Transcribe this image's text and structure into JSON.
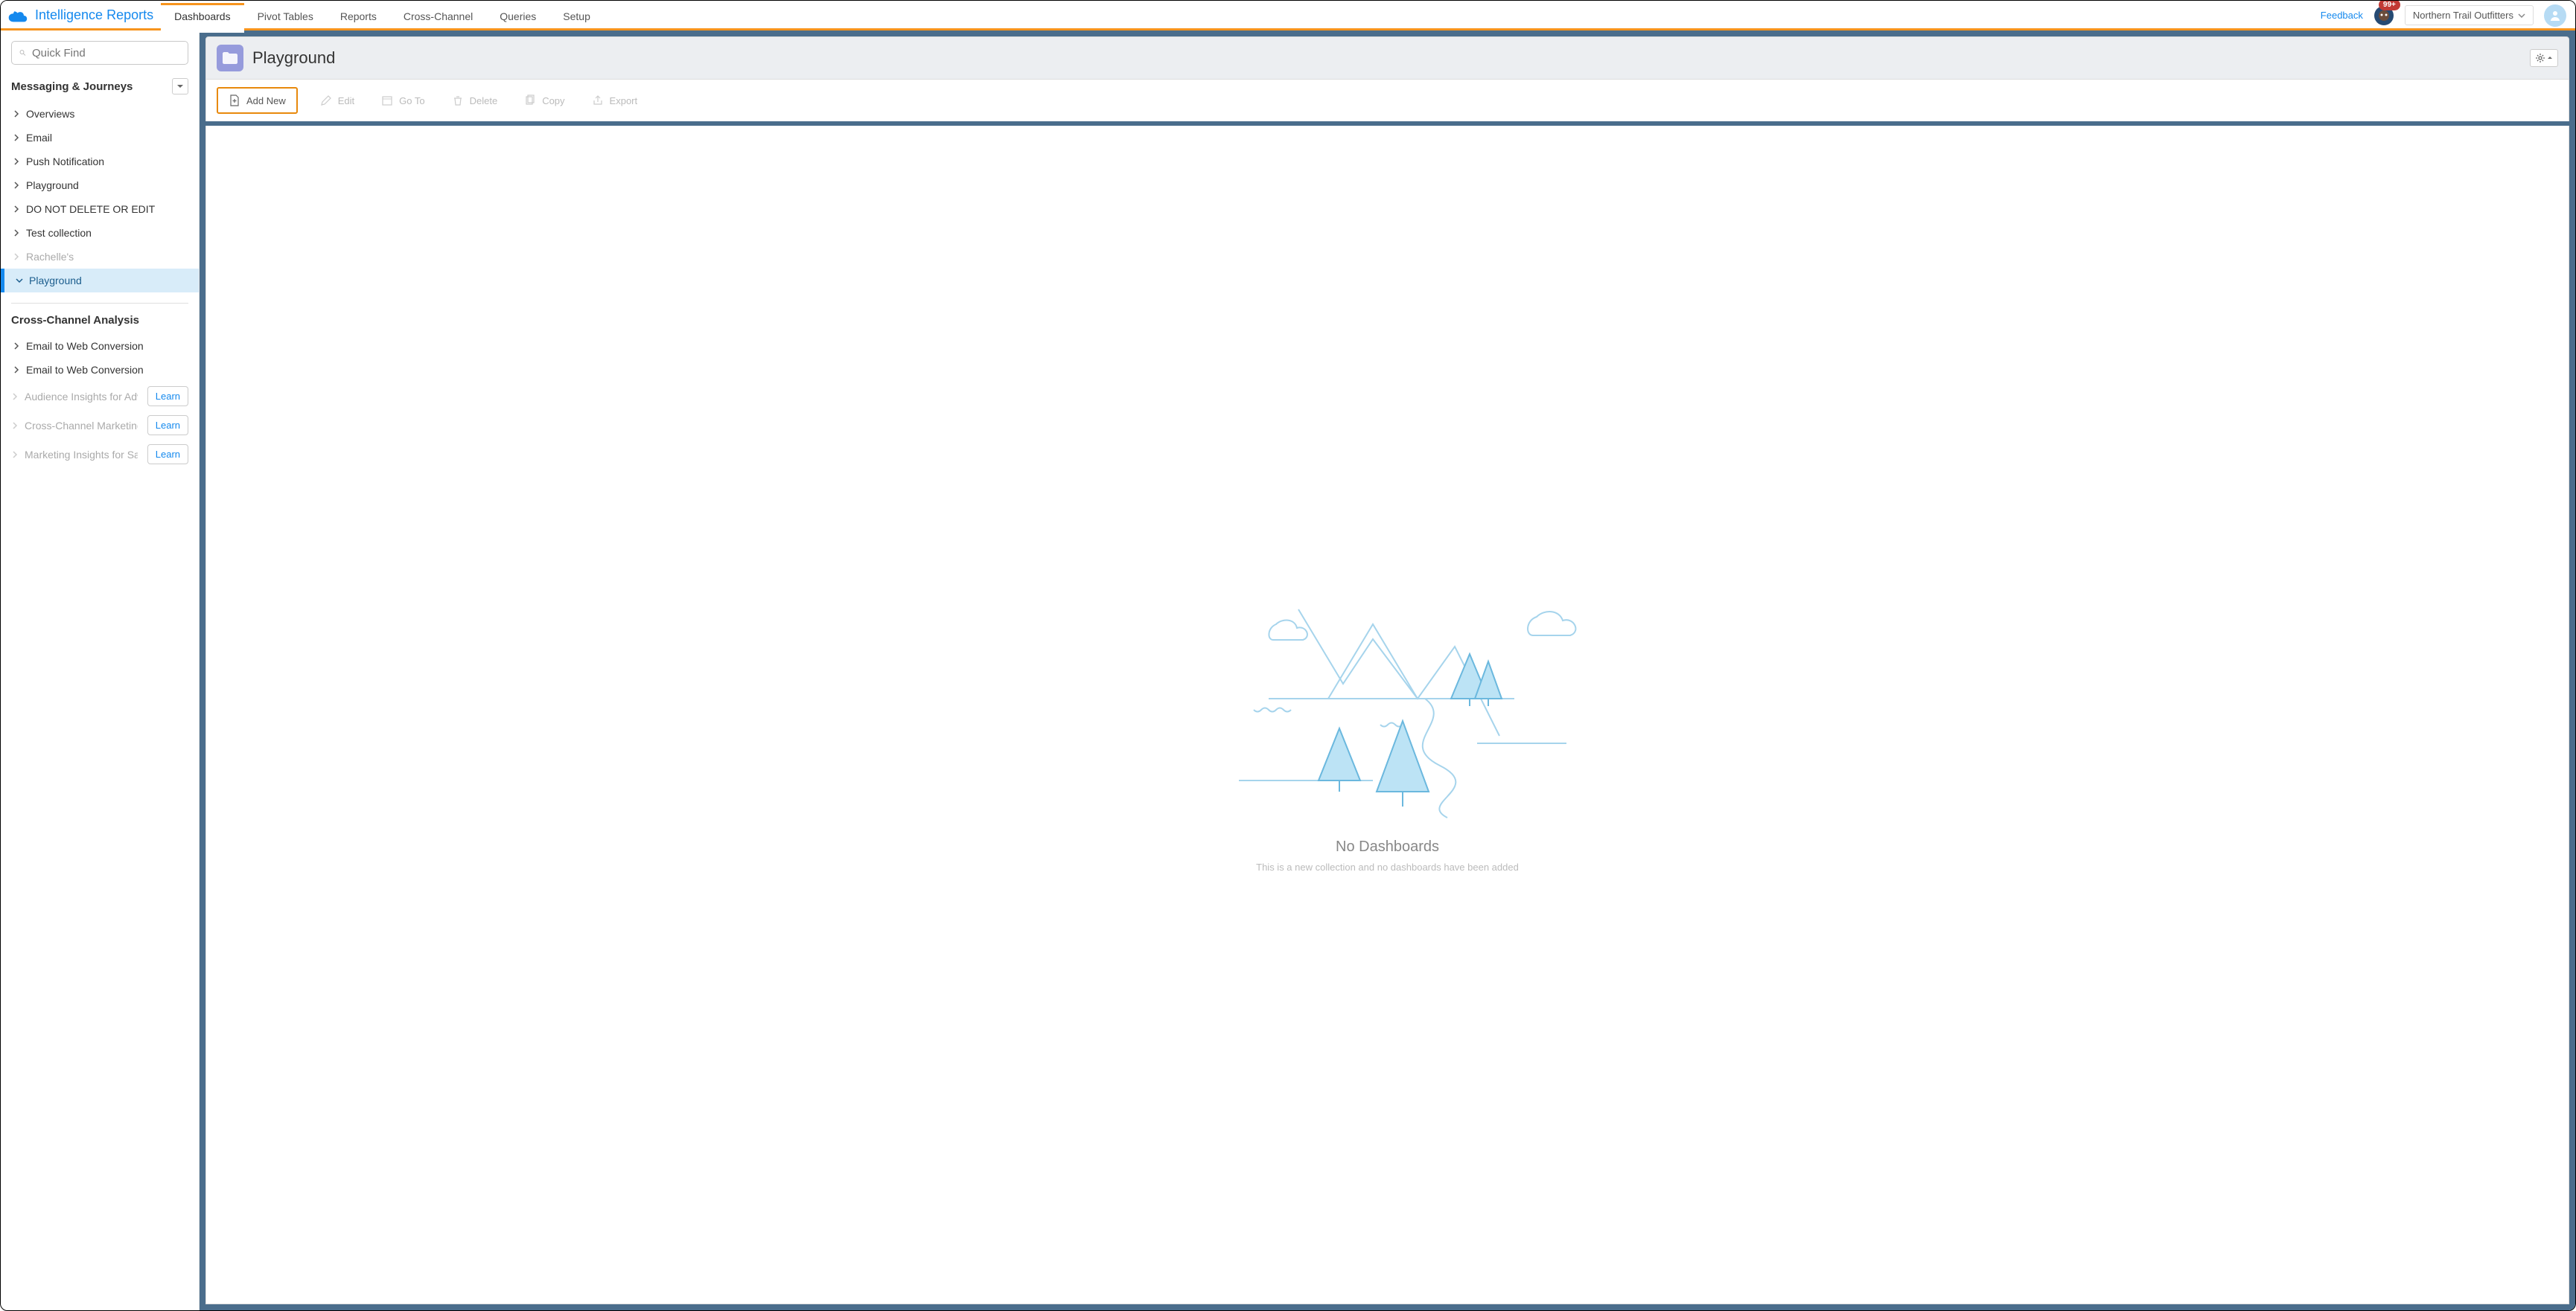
{
  "app": {
    "title": "Intelligence Reports",
    "feedback_label": "Feedback",
    "badge_count": "99+",
    "org_name": "Northern Trail Outfitters"
  },
  "tabs": [
    {
      "label": "Dashboards",
      "active": true
    },
    {
      "label": "Pivot Tables"
    },
    {
      "label": "Reports"
    },
    {
      "label": "Cross-Channel"
    },
    {
      "label": "Queries"
    },
    {
      "label": "Setup"
    }
  ],
  "sidebar": {
    "search_placeholder": "Quick Find",
    "section1_title": "Messaging & Journeys",
    "items1": [
      {
        "label": "Overviews"
      },
      {
        "label": "Email"
      },
      {
        "label": "Push Notification"
      },
      {
        "label": "Playground"
      },
      {
        "label": "DO NOT DELETE OR EDIT"
      },
      {
        "label": "Test collection"
      },
      {
        "label": "Rachelle's",
        "disabled": true
      },
      {
        "label": "Playground",
        "selected": true,
        "expanded": true
      }
    ],
    "section2_title": "Cross-Channel Analysis",
    "items2": [
      {
        "label": "Email to Web Conversion"
      },
      {
        "label": "Email to Web Conversion"
      }
    ],
    "learn_items": [
      {
        "label": "Audience Insights for Adv…",
        "btn": "Learn"
      },
      {
        "label": "Cross-Channel Marketing …",
        "btn": "Learn"
      },
      {
        "label": "Marketing Insights for Sal…",
        "btn": "Learn"
      }
    ]
  },
  "page": {
    "title": "Playground"
  },
  "toolbar": {
    "add_new": "Add New",
    "edit": "Edit",
    "goto": "Go To",
    "delete": "Delete",
    "copy": "Copy",
    "export": "Export"
  },
  "empty": {
    "title": "No Dashboards",
    "subtitle": "This is a new collection and no dashboards have been added"
  }
}
